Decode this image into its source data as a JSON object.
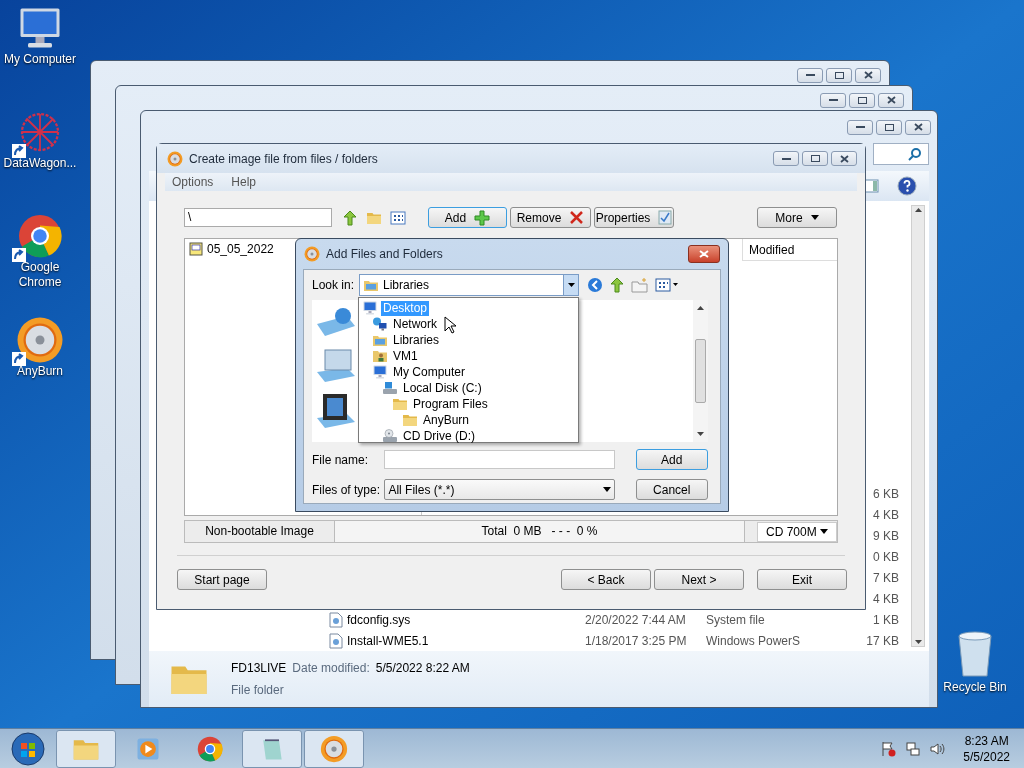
{
  "desktop_icons": [
    {
      "label": "My Computer",
      "kind": "computer"
    },
    {
      "label": "DataWagon...",
      "kind": "mesh"
    },
    {
      "label": "Google Chrome",
      "kind": "chrome"
    },
    {
      "label": "AnyBurn",
      "kind": "disc"
    }
  ],
  "recycle_bin": {
    "label": "Recycle Bin"
  },
  "explorer": {
    "size_fragments": [
      "6 KB",
      "4 KB",
      "9 KB",
      "0 KB",
      "7 KB",
      "4 KB"
    ],
    "rows": [
      {
        "name": "fdconfig.sys",
        "date": "2/20/2022 7:44 AM",
        "type": "System file",
        "size": "1 KB"
      },
      {
        "name": "Install-WME5.1",
        "date": "1/18/2017 3:25 PM",
        "type": "Windows PowerS",
        "size": "17 KB"
      }
    ],
    "details": {
      "name": "FD13LIVE",
      "date_label": "Date modified:",
      "date_value": "5/5/2022 8:22 AM",
      "type": "File folder"
    }
  },
  "anyburn": {
    "title": "Create image file from files / folders",
    "menu": [
      "Options",
      "Help"
    ],
    "path": "\\",
    "toolbar_buttons": [
      {
        "label": "Add",
        "kind": "add",
        "focused": true
      },
      {
        "label": "Remove",
        "kind": "remove",
        "focused": false
      },
      {
        "label": "Properties",
        "kind": "properties",
        "focused": false
      }
    ],
    "more": "More",
    "tree_items": [
      {
        "label": "05_05_2022"
      }
    ],
    "column_header": "Modified",
    "status": {
      "boot": "Non-bootable Image",
      "total": "Total  0 MB   - - -  0 %",
      "media": "CD 700M"
    },
    "nav": {
      "start": "Start page",
      "back": "< Back",
      "next": "Next >",
      "exit": "Exit"
    }
  },
  "dialog": {
    "title": "Add Files and Folders",
    "look_in_label": "Look in:",
    "look_in_value": "Libraries",
    "tree": [
      {
        "label": "Desktop",
        "kind": "desktop",
        "selected": true,
        "children": [
          {
            "label": "Network",
            "kind": "network",
            "selected": false
          },
          {
            "label": "Libraries",
            "kind": "library",
            "selected": false
          },
          {
            "label": "VM1",
            "kind": "user",
            "selected": false
          },
          {
            "label": "My Computer",
            "kind": "computer",
            "selected": false,
            "children": [
              {
                "label": "Local Disk (C:)",
                "kind": "disk",
                "selected": false,
                "children": [
                  {
                    "label": "Program Files",
                    "kind": "folder",
                    "selected": false,
                    "children": [
                      {
                        "label": "AnyBurn",
                        "kind": "folder",
                        "selected": false
                      }
                    ]
                  }
                ]
              },
              {
                "label": "CD Drive (D:)",
                "kind": "cd",
                "selected": false
              }
            ]
          }
        ]
      }
    ],
    "file_name_label": "File name:",
    "files_of_type_label": "Files of type:",
    "files_of_type_value": "All Files (*.*)",
    "buttons": [
      {
        "label": "Add",
        "default": true
      },
      {
        "label": "Cancel",
        "default": false
      }
    ]
  },
  "taskbar": {
    "apps": [
      {
        "kind": "explorer",
        "open": true
      },
      {
        "kind": "media",
        "open": false
      },
      {
        "kind": "chrome",
        "open": false
      },
      {
        "kind": "notepad",
        "open": true
      },
      {
        "kind": "disc",
        "open": true
      }
    ],
    "time": "8:23 AM",
    "date": "5/5/2022"
  }
}
